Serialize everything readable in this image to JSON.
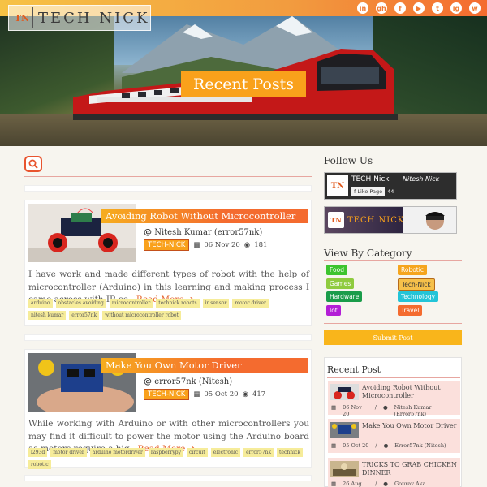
{
  "brand": {
    "logo_mark": "TN",
    "logo_text": "TECH NICK"
  },
  "header": {
    "social_icons": [
      "linkedin-icon",
      "github-icon",
      "facebook-icon",
      "youtube-icon",
      "twitter-icon",
      "instagram-icon",
      "whatsapp-icon"
    ],
    "social_glyphs": [
      "in",
      "gh",
      "f",
      "▶",
      "t",
      "ig",
      "w"
    ],
    "page_title": "Recent Posts"
  },
  "posts": [
    {
      "title": "Avoiding Robot Without Microcontroller",
      "author": "Nitesh Kumar (error57nk)",
      "category": "TECH-NICK",
      "date": "06 Nov 20",
      "views": "181",
      "excerpt": "I have work and made different types of robot with the help of microcontroller (Arduino) in this learning and making process I came across with IR se...",
      "read_more": "Read More",
      "tags": [
        "arduino",
        "obstacles avoiding",
        "microcontroller",
        "technick robots",
        "ir sensor",
        "motor driver",
        "nitesh kumar",
        "error57nk",
        "without microcontroller robot"
      ]
    },
    {
      "title": "Make You Own Motor Driver",
      "author": "error57nk (Nitesh)",
      "category": "TECH-NICK",
      "date": "05 Oct 20",
      "views": "417",
      "excerpt": "While working with Arduino or with other microcontrollers you may find it difficult to power the motor using the Arduino board as motors require a hig...",
      "read_more": "Read More",
      "tags": [
        "l293d",
        "motor driver",
        "arduino motordriver",
        "raspberrypy",
        "circuit",
        "electronic",
        "error57nk",
        "technick",
        "robotic"
      ]
    }
  ],
  "sidebar": {
    "follow_title": "Follow Us",
    "fb_page_name": "TECH Nick",
    "fb_like_label": "Like Page",
    "fb_followers": "44",
    "fb_author": "Nitesh Nick",
    "category_title": "View By Category",
    "categories": [
      {
        "label": "Food",
        "color": "#3dc42e"
      },
      {
        "label": "Robotic",
        "color": "#f5a51e"
      },
      {
        "label": "Games",
        "color": "#8fcb3f"
      },
      {
        "label": "Tech-Nick",
        "color": "#f6c04a"
      },
      {
        "label": "Hardware",
        "color": "#1a9c4a"
      },
      {
        "label": "Technology",
        "color": "#23c4d8"
      },
      {
        "label": "Iot",
        "color": "#b31ed6"
      },
      {
        "label": "Travel",
        "color": "#f46b2f"
      }
    ],
    "submit_label": "Submit Post",
    "recent_title": "Recent Post",
    "recent_posts": [
      {
        "title": "Avoiding Robot Without Microcontroller",
        "date": "06 Nov 20",
        "author": "Nitesh Kumar (Error57nk)"
      },
      {
        "title": "Make You Own Motor Driver",
        "date": "05 Oct 20",
        "author": "Error57nk (Nitesh)"
      },
      {
        "title": "TRICKS TO GRAB CHICKEN DINNER",
        "date": "26 Aug 20",
        "author": "Gourav Aka VikturDonner"
      }
    ]
  }
}
